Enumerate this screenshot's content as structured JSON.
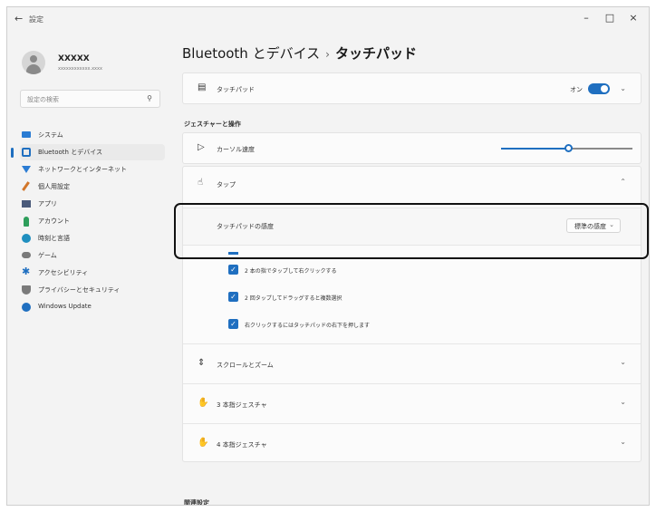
{
  "window": {
    "title": "設定",
    "back": "←",
    "controls": {
      "minimize": "–",
      "maximize": "□",
      "close": "×"
    }
  },
  "profile": {
    "name": "XXXXX",
    "email": "xxxxxxxxxxxx.xxxx"
  },
  "search": {
    "placeholder": "設定の検索"
  },
  "nav": [
    {
      "label": "システム",
      "icon": "monitor-icon",
      "color": "#2b7cd3"
    },
    {
      "label": "Bluetooth とデバイス",
      "icon": "bluetooth-devices-icon",
      "color": "#1f6fc0",
      "active": true
    },
    {
      "label": "ネットワークとインターネット",
      "icon": "network-icon",
      "color": "#2b7cd3"
    },
    {
      "label": "個人用設定",
      "icon": "brush-icon",
      "color": "#d2762a"
    },
    {
      "label": "アプリ",
      "icon": "apps-icon",
      "color": "#4a5a7a"
    },
    {
      "label": "アカウント",
      "icon": "account-icon",
      "color": "#2e9e5b"
    },
    {
      "label": "時刻と言語",
      "icon": "globe-clock-icon",
      "color": "#1f8fbf"
    },
    {
      "label": "ゲーム",
      "icon": "gamepad-icon",
      "color": "#7a7a7a"
    },
    {
      "label": "アクセシビリティ",
      "icon": "accessibility-icon",
      "color": "#1f6fc0"
    },
    {
      "label": "プライバシーとセキュリティ",
      "icon": "shield-icon",
      "color": "#7a7a7a"
    },
    {
      "label": "Windows Update",
      "icon": "update-icon",
      "color": "#1f6fc0"
    }
  ],
  "breadcrumb": {
    "parent": "Bluetooth とデバイス",
    "separator": "›",
    "current": "タッチパッド"
  },
  "touchpad": {
    "label": "タッチパッド",
    "toggle_state": "オン"
  },
  "gestures_heading": "ジェスチャーと操作",
  "cursor_speed": {
    "label": "カーソル速度",
    "value": 0.6
  },
  "taps": {
    "label": "タップ"
  },
  "sensitivity": {
    "label": "タッチパッドの感度",
    "value": "標準の感度"
  },
  "checkboxes": [
    "2 本の指でタップして右クリックする",
    "2 回タップしてドラッグすると複数選択",
    "右クリックするにはタッチパッドの右下を押します"
  ],
  "scroll_zoom": {
    "label": "スクロールとズーム"
  },
  "three_finger": {
    "label": "3 本指ジェスチャ"
  },
  "four_finger": {
    "label": "4 本指ジェスチャ"
  },
  "related_heading": "関連設定",
  "colors": {
    "accent": "#1f6fc0",
    "highlight_border": "#111111"
  }
}
